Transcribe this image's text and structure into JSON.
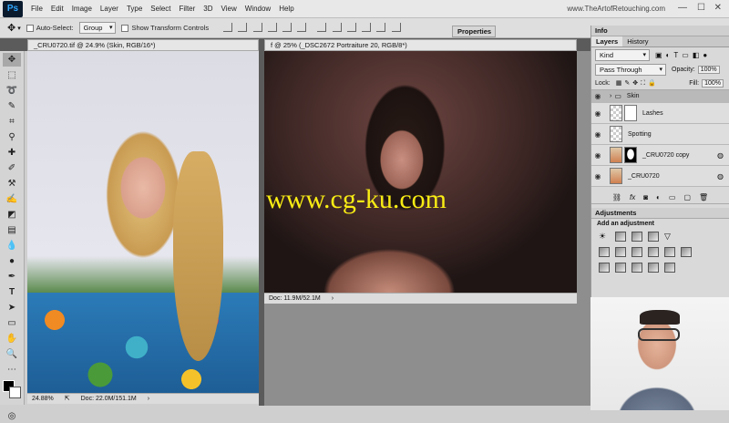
{
  "app": {
    "logo": "Ps",
    "brand": "www.TheArtofRetouching.com"
  },
  "menu": [
    "File",
    "Edit",
    "Image",
    "Layer",
    "Type",
    "Select",
    "Filter",
    "3D",
    "View",
    "Window",
    "Help"
  ],
  "window_controls": {
    "minimize": "—",
    "maximize": "☐",
    "close": "✕"
  },
  "options": {
    "auto_select": "Auto-Select:",
    "auto_select_value": "Group",
    "show_transform": "Show Transform Controls"
  },
  "doc1": {
    "tab": "_CRU0720.tif @ 24.9% (Skin, RGB/16*)",
    "zoom": "24.88%",
    "doc_size": "Doc: 22.0M/151.1M"
  },
  "doc2": {
    "tab": "f @ 25% (_DSC2672 Portraiture 20, RGB/8*)",
    "doc_size": "Doc: 11.9M/52.1M"
  },
  "properties": {
    "label": "Properties"
  },
  "info_panel": {
    "label": "Info"
  },
  "layers_panel": {
    "tabs": [
      "Layers",
      "History"
    ],
    "kind": "Kind",
    "blend_mode": "Pass Through",
    "opacity_label": "Opacity:",
    "opacity_value": "100%",
    "lock_label": "Lock:",
    "fill_label": "Fill:",
    "fill_value": "100%",
    "layers": [
      {
        "name": "Skin",
        "type": "group"
      },
      {
        "name": "Lashes",
        "type": "mask"
      },
      {
        "name": "Spotting",
        "type": "plain"
      },
      {
        "name": "_CRU0720 copy",
        "type": "image-mask"
      },
      {
        "name": "_CRU0720",
        "type": "image"
      }
    ]
  },
  "adjustments": {
    "title": "Adjustments",
    "subtitle": "Add an adjustment"
  },
  "watermark": "www.cg-ku.com",
  "colors": {
    "ps_dark": "#0b1b2e",
    "ps_blue": "#31a8ff",
    "watermark": "#f8ec14"
  }
}
